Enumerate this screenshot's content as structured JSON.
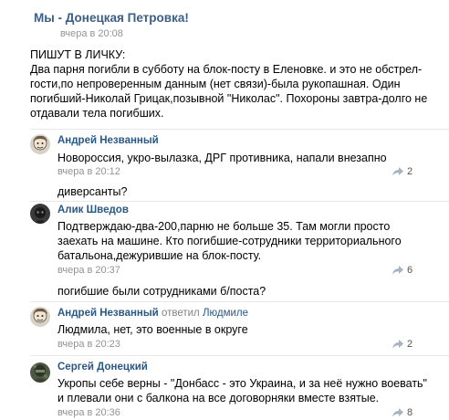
{
  "post": {
    "group_name": "Мы - Донецкая Петровка!",
    "time": "вчера в 20:08",
    "lines": [
      "ПИШУТ В ЛИЧКУ:",
      "Два парня погибли в субботу на блок-посту в Еленовке. и это не обстрел-",
      "гости,по непроверенным данным (нет связи)-была рукопашная. Один",
      "погибший-Николай Грицак,позывной \"Николас\". Похороны завтра-долго не",
      "отдавали тела погибших."
    ]
  },
  "comments": [
    {
      "author": "Андрей Незванный",
      "lines": [
        "Новороссия, укро-вылазка, ДРГ противника, напали внезапно"
      ],
      "time": "вчера в 20:12",
      "share_count": "2"
    },
    {
      "author": "Алик Шведов",
      "lines": [
        "Подтверждаю-два-200,парню не больше 35. Там могли просто",
        "заехать на машине. Кто погибшие-сотрудники территориального",
        "батальона,дежурившие на блок-посту."
      ],
      "time": "вчера в 20:37",
      "share_count": "6"
    },
    {
      "author": "Андрей Незванный",
      "reply_word": "ответил",
      "reply_to": "Людмиле",
      "lines": [
        "Людмила, нет, это военные в округе"
      ],
      "time": "вчера в 20:23",
      "share_count": "2"
    },
    {
      "author": "Сергей Донецкий",
      "lines": [
        "Укропы себе верны - \"Донбасс - это Украина, и за неё нужно воевать\"",
        "и плевали они с балкона на все договорняки вместе взятые."
      ],
      "time": "вчера в 20:36",
      "share_count": "8"
    }
  ],
  "fragments": {
    "question1": "диверсанты?",
    "question2": "погибшие были сотрудниками б/поста?"
  },
  "icons": [
    "avatar-cartoon",
    "avatar-dark",
    "avatar-soldier",
    "share-icon"
  ]
}
